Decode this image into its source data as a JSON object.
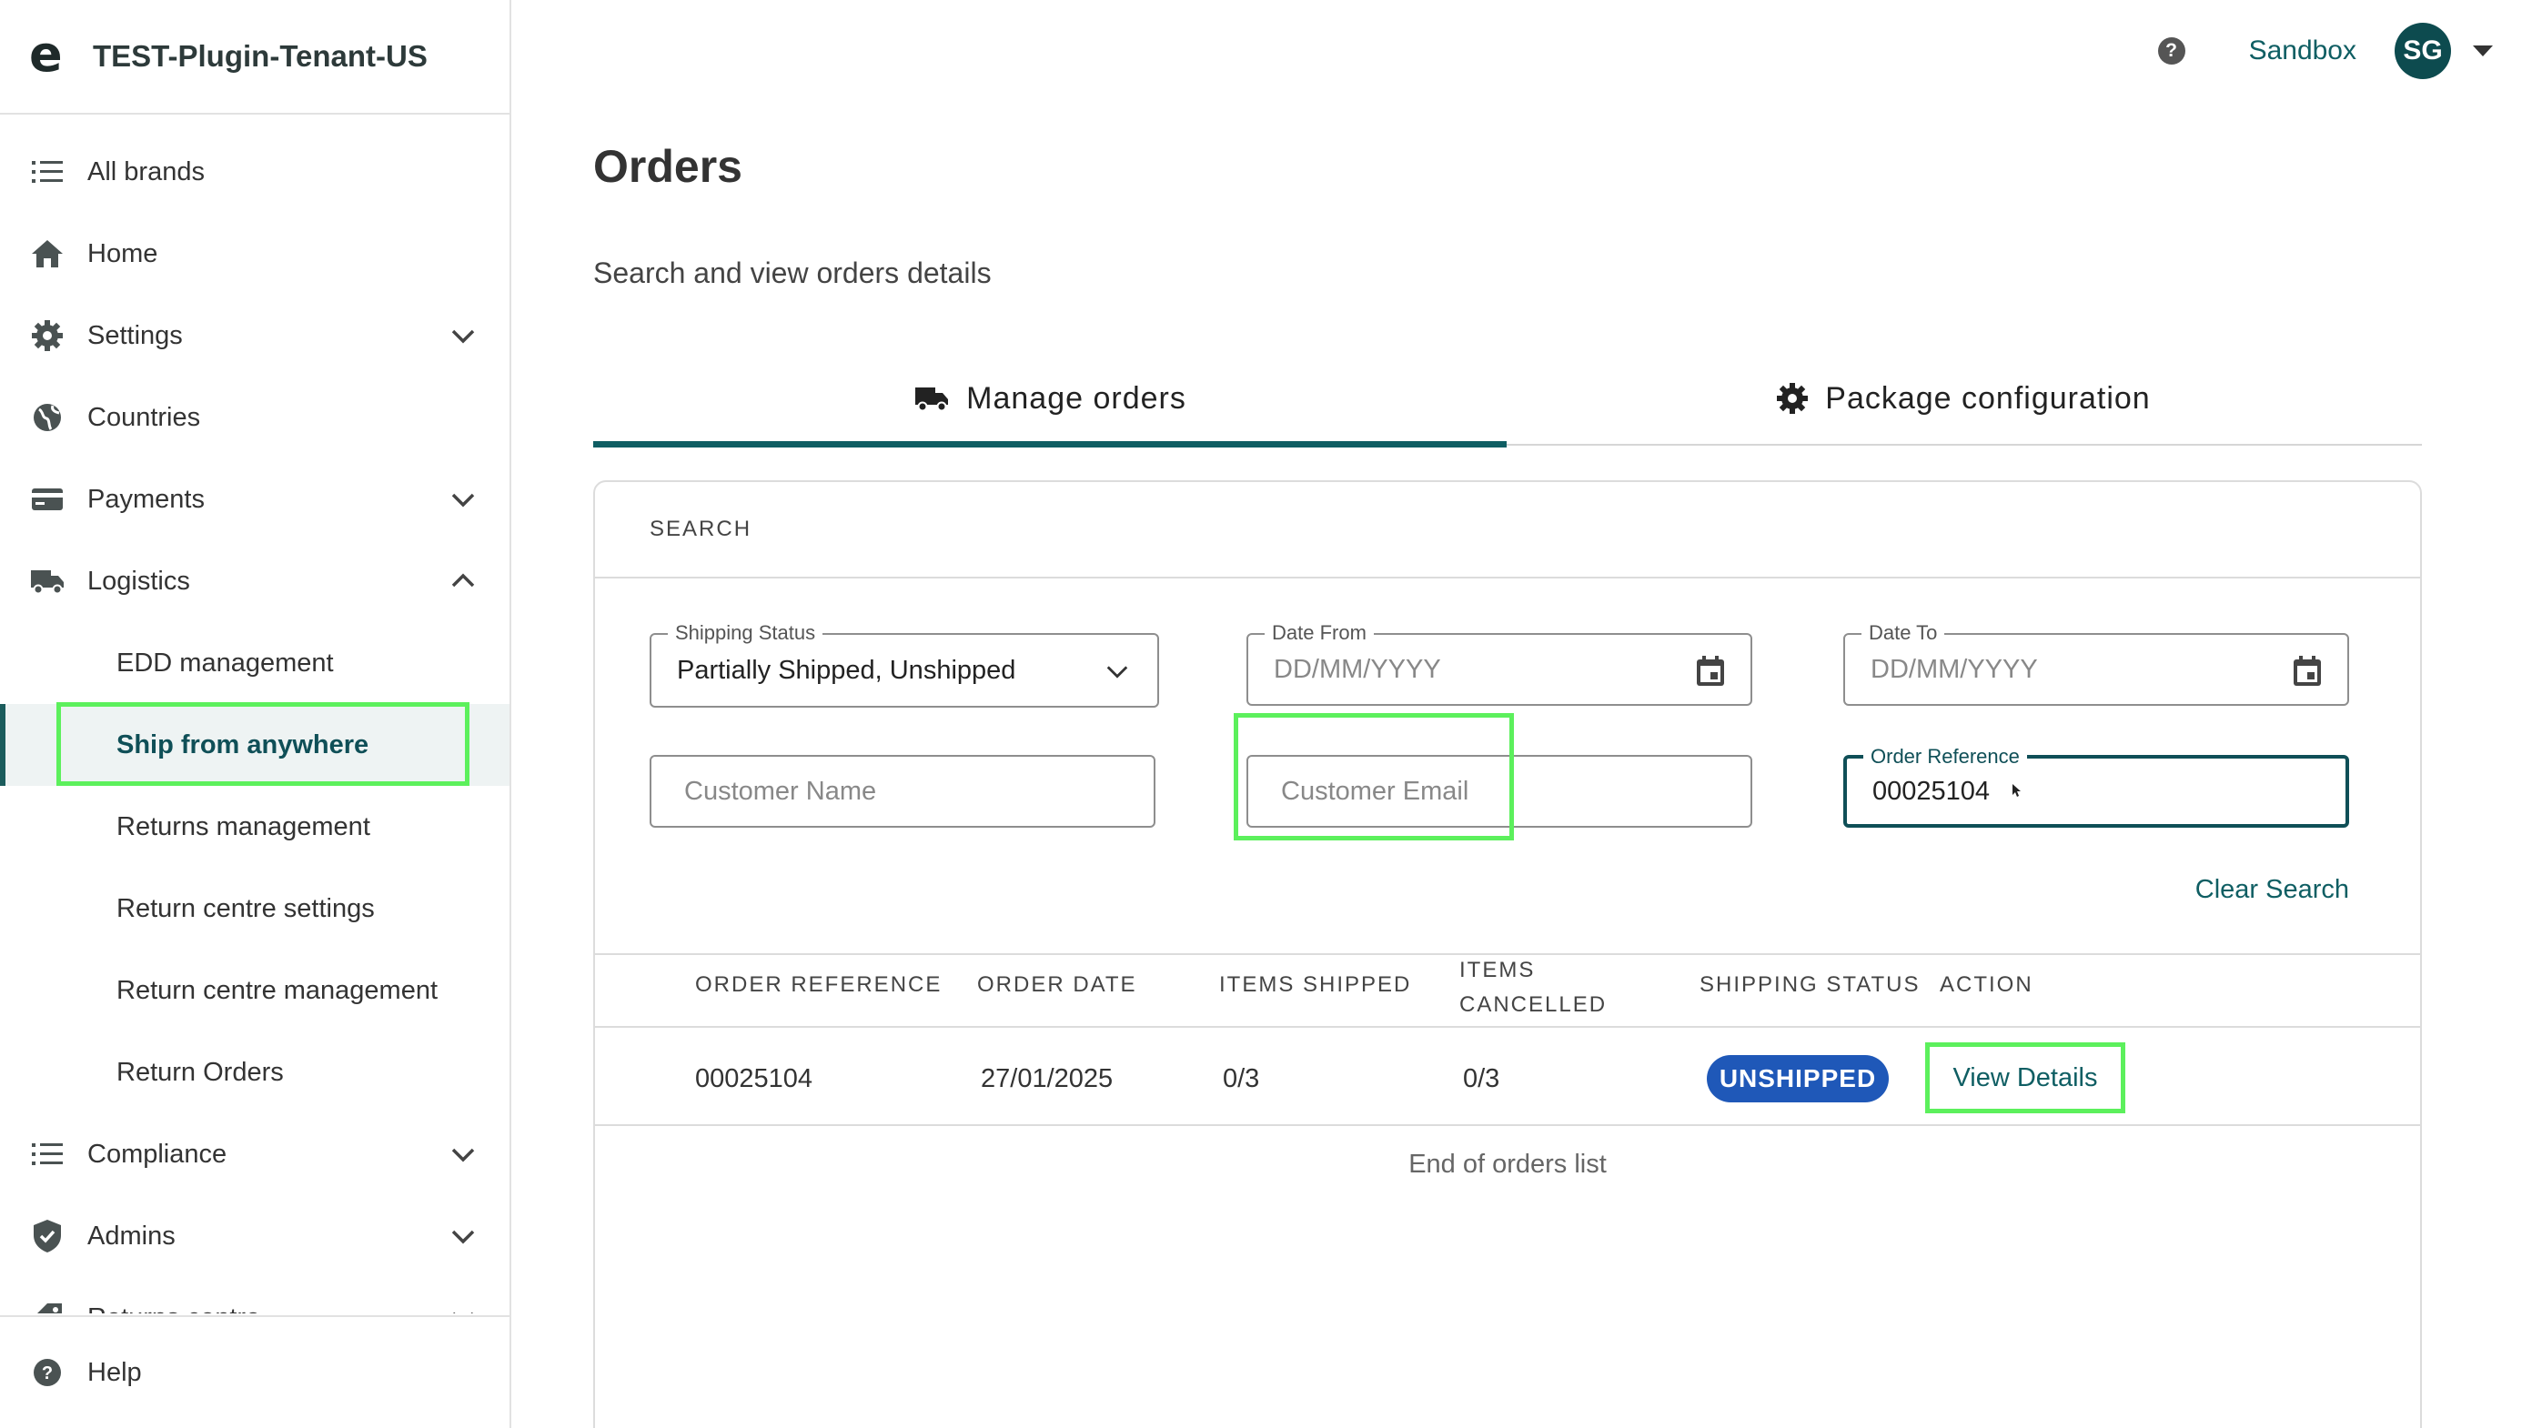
{
  "tenant": {
    "name": "TEST-Plugin-Tenant-US",
    "logo": "e"
  },
  "topbar": {
    "help_icon": "?",
    "environment": "Sandbox",
    "avatar_initials": "SG"
  },
  "nav": {
    "items": [
      {
        "label": "All brands",
        "icon": "list-icon"
      },
      {
        "label": "Home",
        "icon": "home-icon"
      },
      {
        "label": "Settings",
        "icon": "gear-icon"
      },
      {
        "label": "Countries",
        "icon": "globe-icon"
      },
      {
        "label": "Payments",
        "icon": "card-icon"
      },
      {
        "label": "Logistics",
        "icon": "truck-icon"
      },
      {
        "label": "Compliance",
        "icon": "list-icon"
      },
      {
        "label": "Admins",
        "icon": "shield-icon"
      },
      {
        "label": "Returns centre",
        "icon": "tag-icon"
      }
    ],
    "logistics_sub": [
      "EDD management",
      "Ship from anywhere",
      "Returns management",
      "Return centre settings",
      "Return centre management",
      "Return Orders"
    ],
    "help": "Help"
  },
  "page": {
    "title": "Orders",
    "subtitle": "Search and view orders details",
    "tabs": [
      {
        "label": "Manage orders",
        "icon": "truck-icon"
      },
      {
        "label": "Package configuration",
        "icon": "gear-icon"
      }
    ]
  },
  "search": {
    "heading": "SEARCH",
    "shipping_status": {
      "label": "Shipping Status",
      "value": "Partially Shipped, Unshipped"
    },
    "date_from": {
      "label": "Date From",
      "placeholder": "DD/MM/YYYY"
    },
    "date_to": {
      "label": "Date To",
      "placeholder": "DD/MM/YYYY"
    },
    "customer_name": {
      "placeholder": "Customer Name"
    },
    "customer_email": {
      "placeholder": "Customer Email"
    },
    "order_reference": {
      "label": "Order Reference",
      "value": "00025104"
    },
    "clear": "Clear Search"
  },
  "table": {
    "headers": [
      "ORDER REFERENCE",
      "ORDER DATE",
      "ITEMS SHIPPED",
      "ITEMS CANCELLED",
      "SHIPPING STATUS",
      "ACTION"
    ],
    "rows": [
      {
        "order_reference": "00025104",
        "order_date": "27/01/2025",
        "items_shipped": "0/3",
        "items_cancelled": "0/3",
        "status": "UNSHIPPED",
        "action": "View Details"
      }
    ],
    "footer": "End of orders list"
  },
  "colors": {
    "accent": "#0f5e63",
    "badge": "#1f58b8",
    "highlight": "#5cf05c"
  }
}
